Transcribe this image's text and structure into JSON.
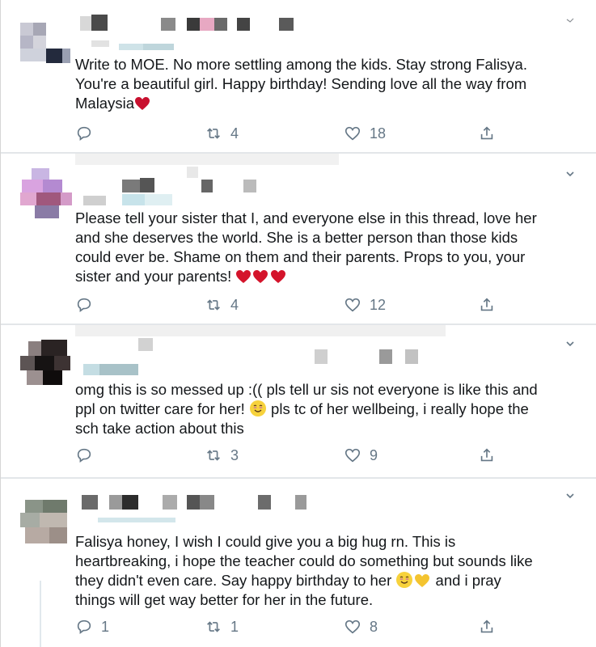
{
  "tweets": [
    {
      "text_parts": [
        "Write to MOE. No more settling among the kids. Stay strong Falisya.\nYou're a beautiful girl. Happy birthday! Sending love all the way from\nMalaysia"
      ],
      "emoji": "heart",
      "replies": "",
      "retweets": "4",
      "likes": "18"
    },
    {
      "text_parts": [
        "Please tell your sister that I, and everyone else in this thread, love her\nand she deserves the world. She is a better person than those kids\ncould ever be. Shame on them and their parents. Props to you, your\nsister and your parents! "
      ],
      "emoji": "three-hearts",
      "replies": "",
      "retweets": "4",
      "likes": "12"
    },
    {
      "text_parts": [
        "omg this is so messed up :(( pls tell ur sis not everyone is like this and\nppl on twitter care for her! ",
        " pls tc of her wellbeing, i really hope the\nsch take action about this"
      ],
      "emoji": "smile",
      "replies": "",
      "retweets": "3",
      "likes": "9"
    },
    {
      "text_parts": [
        "Falisya honey, I wish I could give you a big hug rn. This is\nheartbreaking, i hope the teacher could do something but sounds like\nthey didn't even care. Say happy birthday to her ",
        " and i pray\nthings will get way better for her in the future."
      ],
      "emoji": "smile-heart",
      "replies": "1",
      "retweets": "1",
      "likes": "8"
    }
  ],
  "colors": {
    "text": "#14171a",
    "muted": "#657786",
    "heart_red": "#c8102e",
    "divider": "#e3e6e9"
  },
  "icons": [
    "reply-icon",
    "retweet-icon",
    "like-icon",
    "share-icon",
    "chevron-down-icon"
  ]
}
